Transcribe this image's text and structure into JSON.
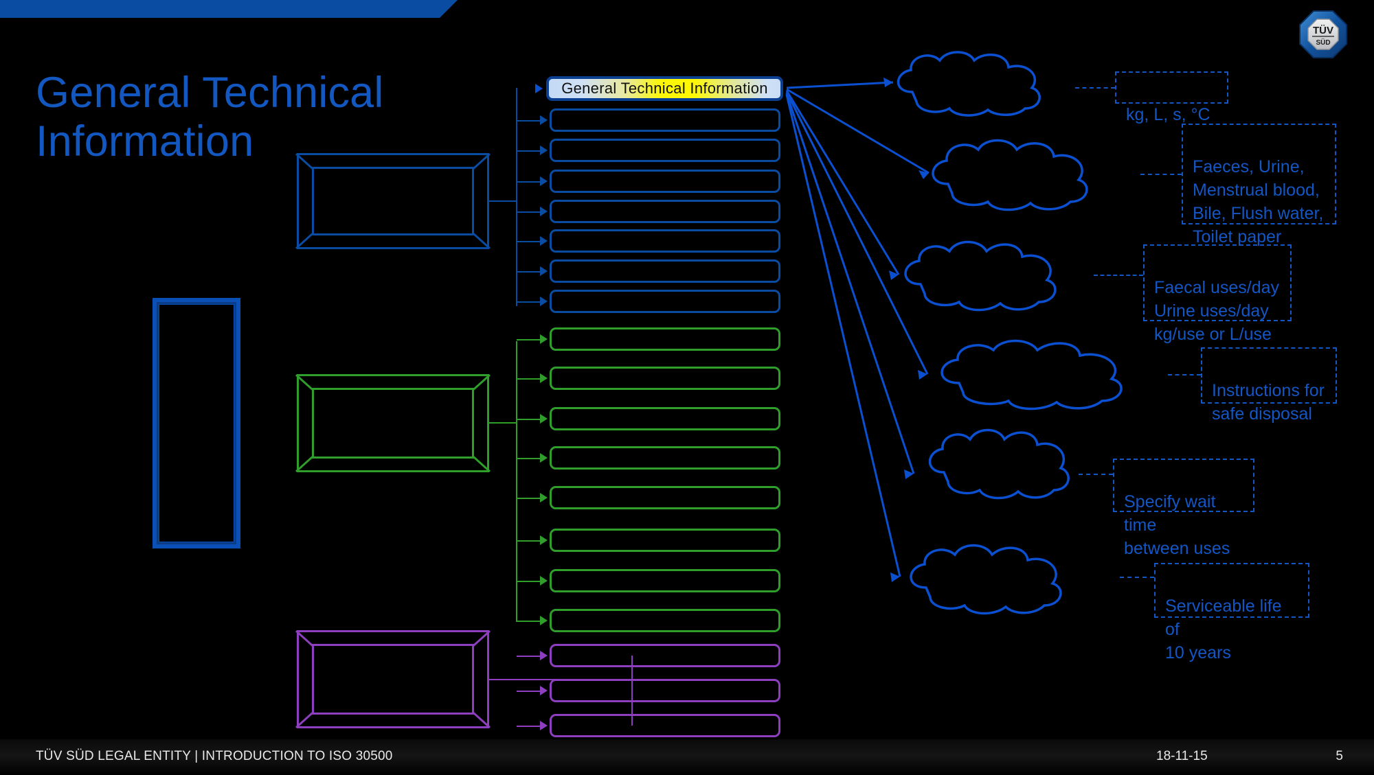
{
  "slide": {
    "title_line1": "General Technical",
    "title_line2": "Information",
    "background_color": "#000000",
    "accent_blue": "#0b4ca3",
    "accent_green": "#2f9e2a",
    "accent_purple": "#8e3fc0"
  },
  "header_bar": {
    "label": "General Technical Information",
    "fill_start_color": "#c3d9f5",
    "fill_mid_color": "#fbf60a",
    "border_color": "#0b3f91"
  },
  "groups": [
    {
      "name": "blue-group",
      "color": "#0b4ca3",
      "box_label": "",
      "items": [
        {
          "label": ""
        },
        {
          "label": ""
        },
        {
          "label": ""
        },
        {
          "label": ""
        },
        {
          "label": ""
        },
        {
          "label": ""
        },
        {
          "label": ""
        }
      ]
    },
    {
      "name": "green-group",
      "color": "#2f9e2a",
      "box_label": "",
      "items": [
        {
          "label": ""
        },
        {
          "label": ""
        },
        {
          "label": ""
        },
        {
          "label": ""
        },
        {
          "label": ""
        },
        {
          "label": ""
        },
        {
          "label": ""
        },
        {
          "label": ""
        }
      ]
    },
    {
      "name": "purple-group",
      "color": "#8e3fc0",
      "box_label": "",
      "items": [
        {
          "label": ""
        },
        {
          "label": ""
        },
        {
          "label": ""
        }
      ]
    }
  ],
  "callouts": [
    {
      "id": "callout-units",
      "text": "kg, L, s, °C"
    },
    {
      "id": "callout-waste",
      "text": "Faeces, Urine,\nMenstrual blood,\nBile, Flush water,\nToilet paper"
    },
    {
      "id": "callout-usage",
      "text": "Faecal uses/day\nUrine uses/day\nkg/use or L/use"
    },
    {
      "id": "callout-disposal",
      "text": "Instructions for\nsafe disposal"
    },
    {
      "id": "callout-waittime",
      "text": "Specify wait time\nbetween uses"
    },
    {
      "id": "callout-life",
      "text": "Serviceable life of\n10 years"
    }
  ],
  "footer": {
    "left_text": "TÜV SÜD LEGAL ENTITY | INTRODUCTION TO ISO 30500",
    "date": "18-11-15",
    "page": "5"
  },
  "logo": {
    "top_text": "TÜV",
    "bottom_text": "SÜD"
  }
}
